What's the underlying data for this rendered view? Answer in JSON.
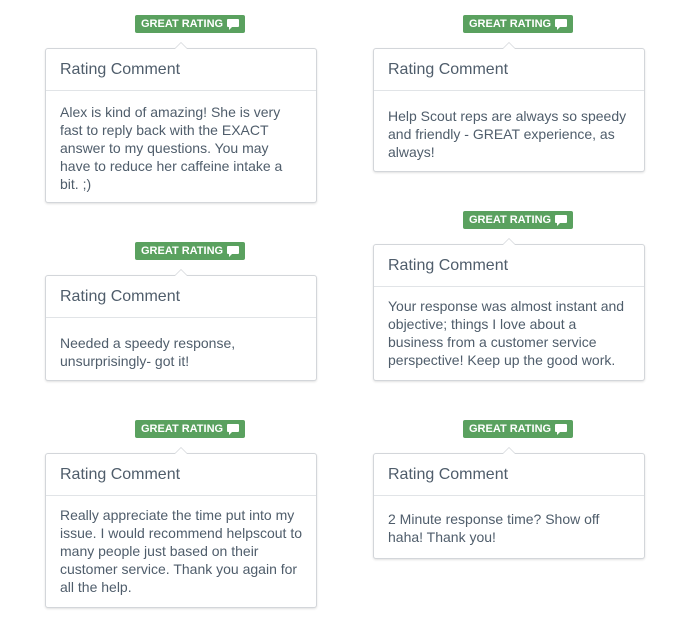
{
  "colors": {
    "badge_green": "#5aa15f",
    "card_border": "#d3d6da",
    "text": "#4f5d6b"
  },
  "cards": [
    {
      "badge_label": "GREAT RATING",
      "badge_icon": "speech-bubble-icon",
      "heading": "Rating Comment",
      "comment": "Alex is kind of amazing! She is very fast to reply back with the EXACT answer to my questions. You may have to reduce her caffeine intake a bit. ;)"
    },
    {
      "badge_label": "GREAT RATING",
      "badge_icon": "speech-bubble-icon",
      "heading": "Rating Comment",
      "comment": "Help Scout reps are always so speedy and friendly - GREAT experience, as always!"
    },
    {
      "badge_label": "GREAT RATING",
      "badge_icon": "speech-bubble-icon",
      "heading": "Rating Comment",
      "comment": "Needed a speedy response, unsurprisingly- got it!"
    },
    {
      "badge_label": "GREAT RATING",
      "badge_icon": "speech-bubble-icon",
      "heading": "Rating Comment",
      "comment": "Your response was almost instant and objective; things I love about a business from a customer service perspective! Keep up the good work."
    },
    {
      "badge_label": "GREAT RATING",
      "badge_icon": "speech-bubble-icon",
      "heading": "Rating Comment",
      "comment": "Really appreciate the time put into my issue. I would recommend helpscout to many people just based on their customer service. Thank you again for all the help."
    },
    {
      "badge_label": "GREAT RATING",
      "badge_icon": "speech-bubble-icon",
      "heading": "Rating Comment",
      "comment": "2 Minute response time? Show off haha! Thank you!"
    }
  ]
}
